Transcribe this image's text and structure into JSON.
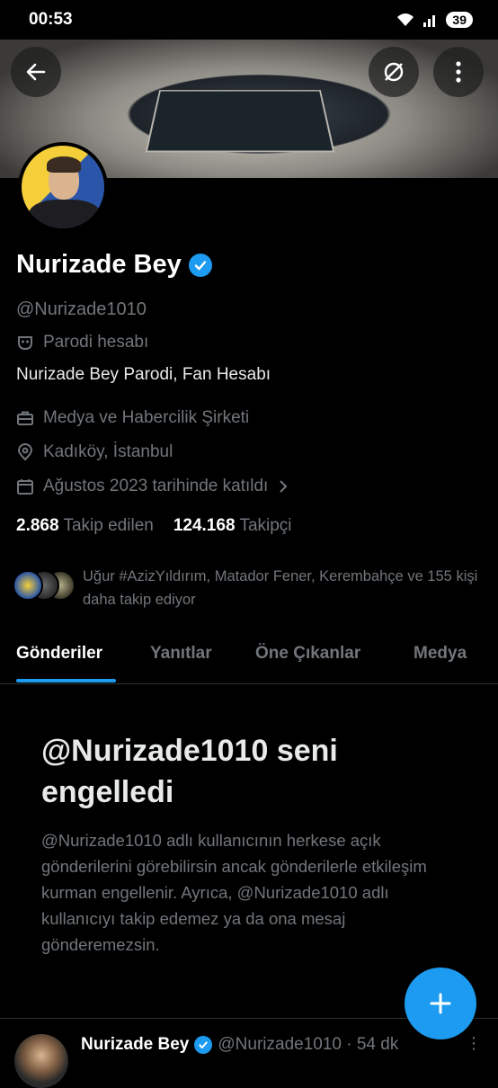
{
  "status_bar": {
    "time": "00:53",
    "battery": "39",
    "icons": [
      "wifi-icon",
      "signal-icon",
      "battery-icon"
    ]
  },
  "header": {
    "back_icon": "arrow-left-icon",
    "grok_icon": "grok-icon",
    "more_icon": "more-vertical-icon"
  },
  "profile": {
    "name": "Nurizade Bey",
    "handle": "@Nurizade1010",
    "parody_label": "Parodi hesabı",
    "bio": "Nurizade Bey Parodi, Fan Hesabı",
    "category": "Medya ve Habercilik Şirketi",
    "location": "Kadıköy, İstanbul",
    "joined": "Ağustos 2023 tarihinde katıldı",
    "following_count": "2.868",
    "following_label": "Takip edilen",
    "followers_count": "124.168",
    "followers_label": "Takipçi",
    "followed_by_text": "Uğur #AzizYıldırım, Matador Fener, Kerembahçe ve 155 kişi daha takip ediyor"
  },
  "tabs": [
    {
      "label": "Gönderiler",
      "active": true
    },
    {
      "label": "Yanıtlar",
      "active": false
    },
    {
      "label": "Öne Çıkanlar",
      "active": false
    },
    {
      "label": "Medya",
      "active": false
    }
  ],
  "blocked": {
    "title": "@Nurizade1010 seni engelledi",
    "description": "@Nurizade1010 adlı kullanıcının herkese açık gönderilerini görebilirsin ancak gönderilerle etkileşim kurman engellenir. Ayrıca, @Nurizade1010 adlı kullanıcıyı takip edemez ya da ona mesaj gönderemezsin."
  },
  "post_preview": {
    "name": "Nurizade Bey",
    "meta": "@Nurizade1010 · 54 dk"
  },
  "colors": {
    "accent": "#1d9bf0",
    "background": "#000000",
    "muted": "#71767b"
  }
}
